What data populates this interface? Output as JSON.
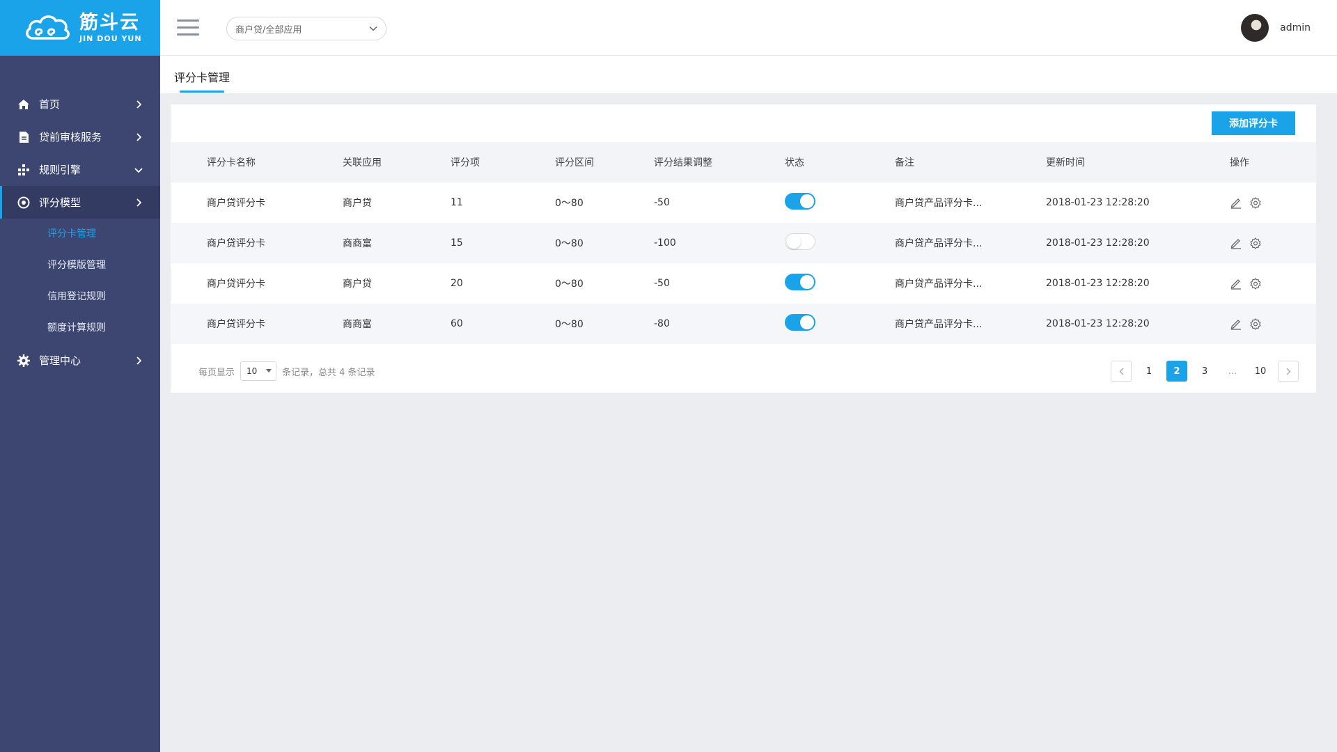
{
  "brand": {
    "name_cn": "筋斗云",
    "name_en": "JIN DOU YUN"
  },
  "colors": {
    "accent": "#1aa3e8",
    "sidebar": "#3d4671",
    "sidebar_active": "#333b62"
  },
  "sidebar": {
    "items": [
      {
        "label": "首页",
        "icon": "home-icon"
      },
      {
        "label": "贷前审核服务",
        "icon": "document-icon"
      },
      {
        "label": "规则引擎",
        "icon": "nodes-icon"
      },
      {
        "label": "评分模型",
        "icon": "target-icon"
      },
      {
        "label": "管理中心",
        "icon": "gear-icon"
      }
    ],
    "submenu": [
      {
        "label": "评分卡管理"
      },
      {
        "label": "评分模版管理"
      },
      {
        "label": "信用登记规则"
      },
      {
        "label": "额度计算规则"
      }
    ]
  },
  "header": {
    "app_select": "商户贷/全部应用",
    "username": "admin"
  },
  "page": {
    "tab": "评分卡管理"
  },
  "toolbar": {
    "add_label": "添加评分卡"
  },
  "table": {
    "columns": [
      "评分卡名称",
      "关联应用",
      "评分项",
      "评分区间",
      "评分结果调整",
      "状态",
      "备注",
      "更新时间",
      "操作"
    ],
    "rows": [
      {
        "name": "商户贷评分卡",
        "app": "商户贷",
        "items": "11",
        "range": "0～80",
        "adjust": "-50",
        "status": true,
        "note": "商户贷产品评分卡...",
        "updated": "2018-01-23 12:28:20"
      },
      {
        "name": "商户贷评分卡",
        "app": "商商富",
        "items": "15",
        "range": "0～80",
        "adjust": "-100",
        "status": false,
        "note": "商户贷产品评分卡...",
        "updated": "2018-01-23 12:28:20"
      },
      {
        "name": "商户贷评分卡",
        "app": "商户贷",
        "items": "20",
        "range": "0～80",
        "adjust": "-50",
        "status": true,
        "note": "商户贷产品评分卡...",
        "updated": "2018-01-23 12:28:20"
      },
      {
        "name": "商户贷评分卡",
        "app": "商商富",
        "items": "60",
        "range": "0～80",
        "adjust": "-80",
        "status": true,
        "note": "商户贷产品评分卡...",
        "updated": "2018-01-23 12:28:20"
      }
    ]
  },
  "footer": {
    "per_page_prefix": "每页显示",
    "per_page_value": "10",
    "per_page_suffix": "条记录，总共 4 条记录"
  },
  "pagination": {
    "pages": [
      "1",
      "2",
      "3"
    ],
    "current": "2",
    "ellipsis": "...",
    "last": "10"
  }
}
